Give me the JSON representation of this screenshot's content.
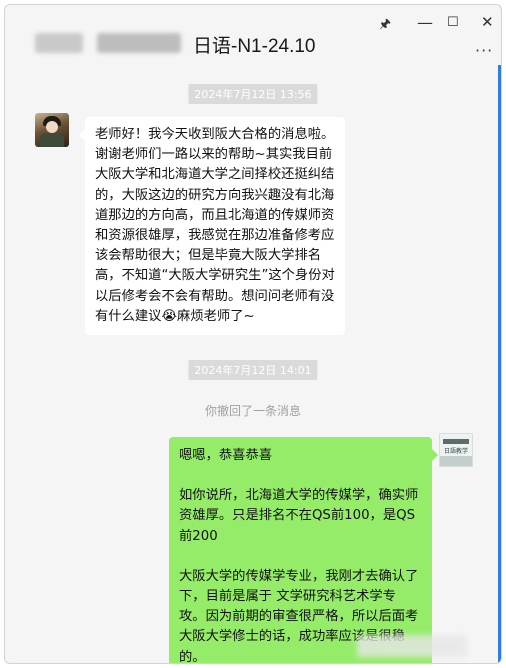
{
  "window": {
    "title": "日语-N1-24.10",
    "controls": {
      "pin": "🖈",
      "minimize": "—",
      "maximize": "☐",
      "close": "✕",
      "more": "···"
    }
  },
  "messages": {
    "timestamp_1": "2024年7月12日 13:56",
    "incoming_text": "老师好！我今天收到阪大合格的消息啦。谢谢老师们一路以来的帮助~其实我目前大阪大学和北海道大学之间择校还挺纠结的，大阪这边的研究方向我兴趣没有北海道那边的方向高，而且北海道的传媒师资和资源很雄厚，我感觉在那边准备修考应该会帮助很大；但是毕竟大阪大学排名高，不知道“大阪大学研究生”这个身份对以后修考会不会有帮助。想问问老师有没有什么建议😭麻烦老师了~",
    "timestamp_2": "2024年7月12日 14:01",
    "recall_notice": "你撤回了一条消息",
    "reply_paragraphs": [
      "嗯嗯，恭喜恭喜",
      "如你说所，北海道大学的传媒学，确实师资雄厚。只是排名不在QS前100，是QS前200",
      "大阪大学的传媒学专业，我刚才去确认了下，目前是属于 文学研究科艺术学专攻。因为前期的审查很严格，所以后面考大阪大学修士的话，成功率应该是很稳的。"
    ]
  },
  "avatar_right": {
    "label": "日語教学"
  },
  "colors": {
    "bubble_out": "#95ec69",
    "bubble_in": "#ffffff",
    "background": "#f5f5f5",
    "accent": "#2f7de1"
  }
}
